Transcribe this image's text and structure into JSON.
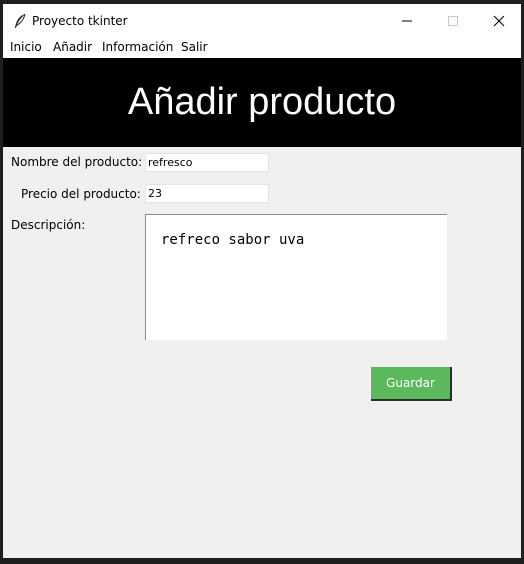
{
  "window": {
    "title": "Proyecto tkinter",
    "icon": "feather-icon"
  },
  "menubar": {
    "items": [
      "Inicio",
      "Añadir",
      "Información",
      "Salir"
    ]
  },
  "banner": {
    "title": "Añadir producto",
    "bg_color": "#000000",
    "text_color": "#ffffff"
  },
  "form": {
    "nombre": {
      "label": "Nombre del producto:",
      "value": "refresco"
    },
    "precio": {
      "label": "Precio del producto:",
      "value": "23"
    },
    "descripcion": {
      "label": "Descripción:",
      "value": "refreco sabor uva"
    },
    "save_label": "Guardar",
    "save_color": "#5cb85c"
  }
}
